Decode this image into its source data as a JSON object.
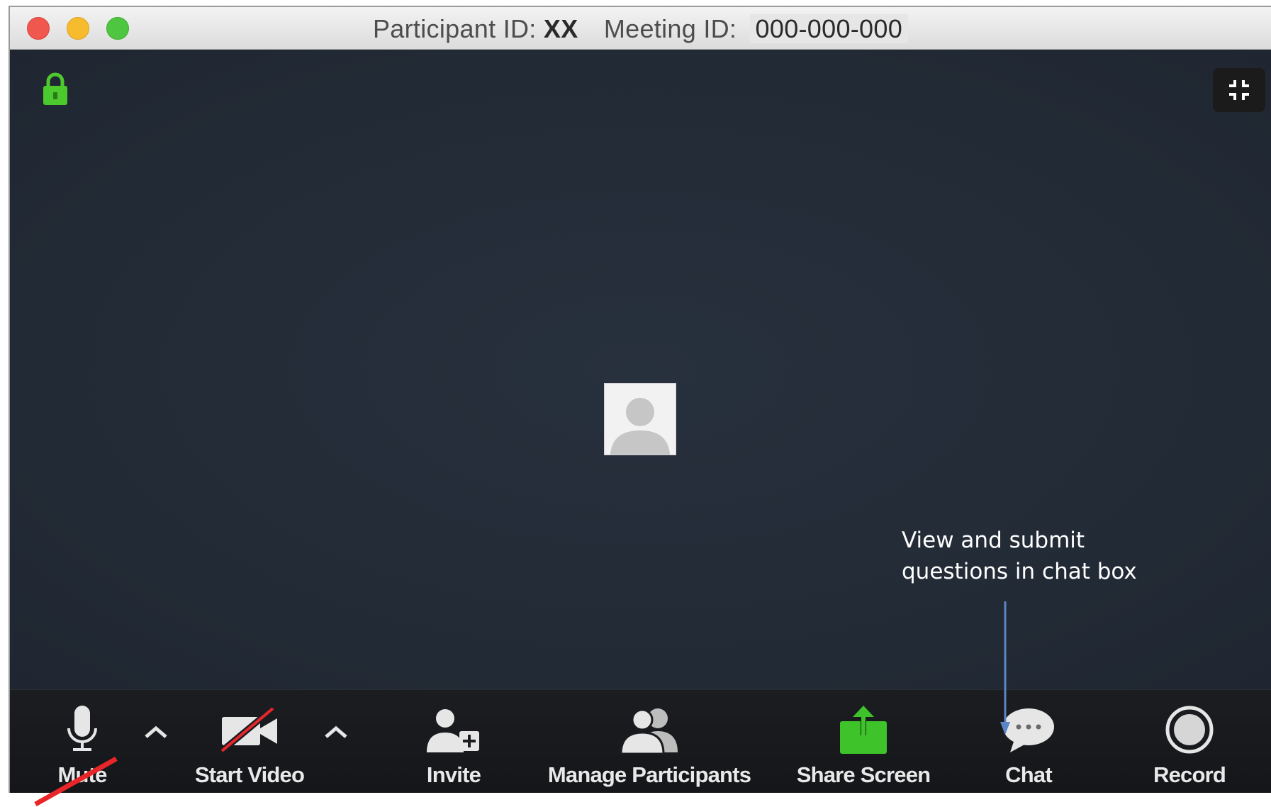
{
  "window": {
    "title_participant_label": "Participant ID:",
    "title_participant_value": "XX",
    "title_meeting_label": "Meeting ID:",
    "title_meeting_value": "000-000-000"
  },
  "annotation": {
    "line1": "View and submit",
    "line2": "questions in chat box"
  },
  "toolbar": {
    "mute_label": "Mute",
    "start_video_label": "Start Video",
    "invite_label": "Invite",
    "manage_participants_label": "Manage Participants",
    "share_screen_label": "Share Screen",
    "chat_label": "Chat",
    "record_label": "Record"
  },
  "colors": {
    "video_bg": "#232a36",
    "toolbar_bg": "#1a1c20",
    "lock_green": "#4cc92c",
    "share_green": "#3ec42a",
    "annotation_arrow": "#5a86c5",
    "slash_red": "#e8262a"
  },
  "icons": {
    "lock": "lock-icon",
    "fullscreen": "fullscreen-exit-icon",
    "mute": "microphone-icon",
    "video": "video-camera-off-icon",
    "invite": "add-user-icon",
    "participants": "users-icon",
    "share": "share-screen-icon",
    "chat": "chat-bubble-icon",
    "record": "record-icon"
  }
}
